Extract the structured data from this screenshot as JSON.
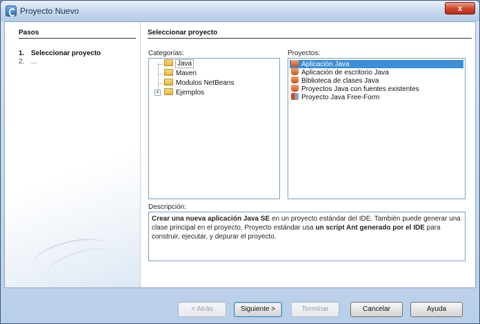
{
  "window": {
    "title": "Proyecto Nuevo",
    "close_label": "x"
  },
  "steps": {
    "heading": "Pasos",
    "items": [
      {
        "number": "1.",
        "label": "Seleccionar proyecto"
      },
      {
        "number": "2.",
        "label": "..."
      }
    ]
  },
  "main": {
    "heading": "Seleccionar proyecto",
    "categories_label": "Categorías:",
    "projects_label": "Proyectos:",
    "description_label": "Descripción:",
    "categories": [
      {
        "label": "Java",
        "selected": true
      },
      {
        "label": "Maven"
      },
      {
        "label": "Modulos NetBeans"
      },
      {
        "label": "Ejemplos",
        "expandable": true
      }
    ],
    "expander_symbol": "+",
    "projects": [
      {
        "label": "Aplicación Java",
        "selected": true,
        "icon": "java-cup-icon"
      },
      {
        "label": "Aplicación de escritorio Java",
        "icon": "java-cup-icon"
      },
      {
        "label": "Biblioteca de clases Java",
        "icon": "java-cup-icon"
      },
      {
        "label": "Proyectos Java con fuentes existentes",
        "icon": "java-cup-icon"
      },
      {
        "label": "Proyecto Java Free-Form",
        "icon": "freeform-project-icon"
      }
    ],
    "description": {
      "part1": "Crear una nueva aplicación Java SE",
      "part2": " en un proyecto estándar del IDE. También puede generar una clase principal en el proyecto. Proyecto estándar usa ",
      "part3": "un script Ant generado por el IDE",
      "part4": " para construir, ejecutar, y depurar el proyecto."
    }
  },
  "buttons": {
    "back": "< Atrás",
    "next": "Siguiente >",
    "finish": "Terminar",
    "cancel": "Cancelar",
    "help": "Ayuda"
  },
  "colors": {
    "selection": "#3b8ed8",
    "titlebar": "#c7d9ee",
    "close_button": "#d2472c"
  }
}
